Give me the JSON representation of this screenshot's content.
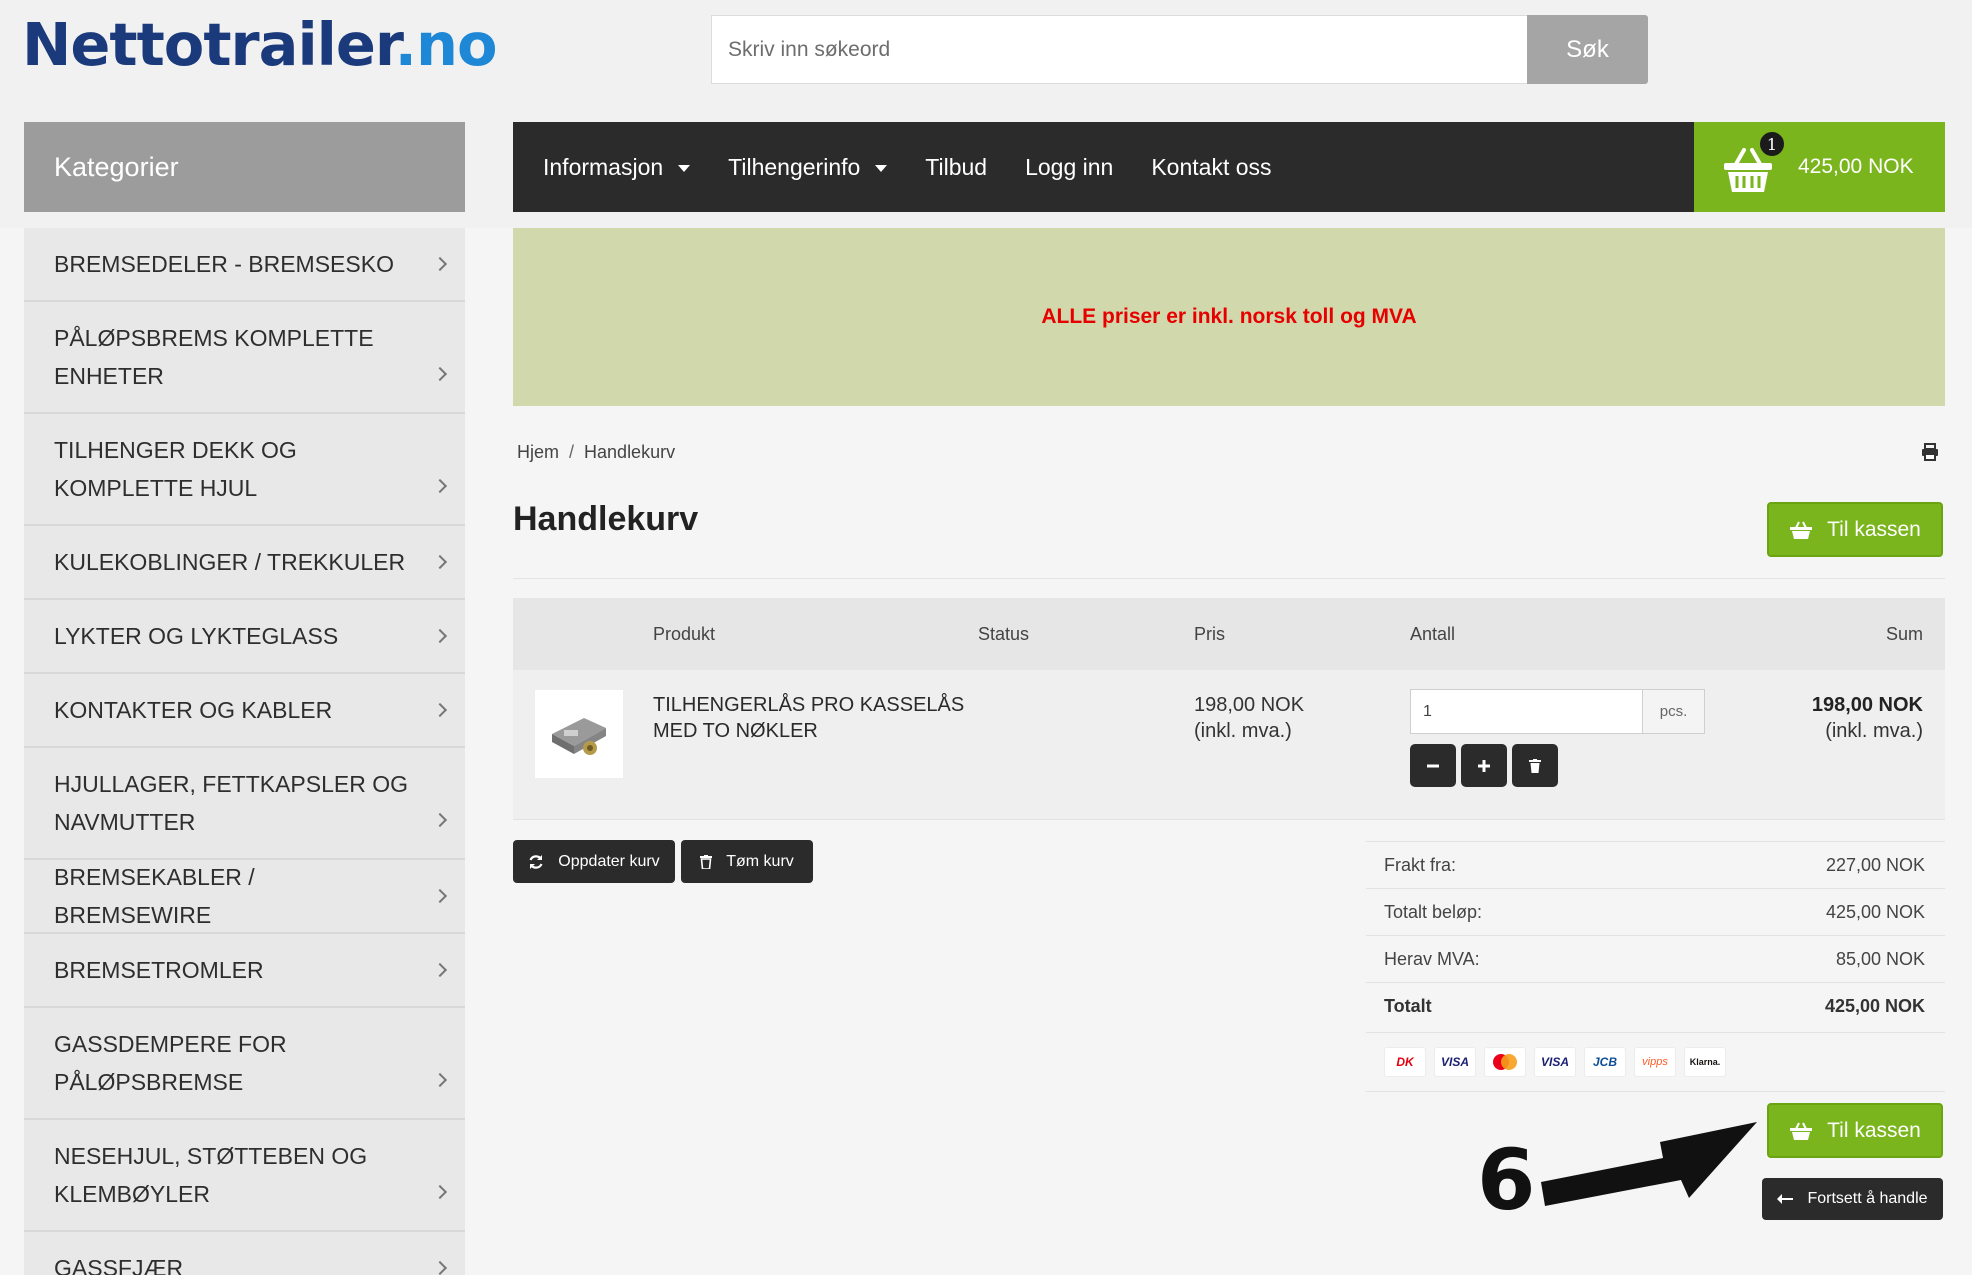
{
  "header": {
    "logo_part1": "Nettotrailer",
    "logo_part2": ".no",
    "search_placeholder": "Skriv inn søkeord",
    "search_button": "Søk"
  },
  "sidebar": {
    "title": "Kategorier",
    "items": [
      {
        "label": "BREMSEDELER - BREMSESKO"
      },
      {
        "label": "PÅLØPSBREMS KOMPLETTE ENHETER"
      },
      {
        "label": "TILHENGER DEKK OG KOMPLETTE HJUL"
      },
      {
        "label": "KULEKOBLINGER / TREKKULER"
      },
      {
        "label": "LYKTER OG LYKTEGLASS"
      },
      {
        "label": "KONTAKTER OG KABLER"
      },
      {
        "label": "HJULLAGER, FETTKAPSLER OG NAVMUTTER"
      },
      {
        "label": "BREMSEKABLER / BREMSEWIRE"
      },
      {
        "label": "BREMSETROMLER"
      },
      {
        "label": "GASSDEMPERE FOR PÅLØPSBREMSE"
      },
      {
        "label": "NESEHJUL, STØTTEBEN OG KLEMBØYLER"
      },
      {
        "label": "GASSFJÆR"
      }
    ]
  },
  "nav": {
    "items": [
      {
        "label": "Informasjon"
      },
      {
        "label": "Tilhengerinfo"
      },
      {
        "label": "Tilbud"
      },
      {
        "label": "Logg inn"
      },
      {
        "label": "Kontakt oss"
      }
    ],
    "cart_count": "1",
    "cart_total": "425,00 NOK"
  },
  "banner": {
    "text": "ALLE priser er inkl. norsk toll og MVA"
  },
  "breadcrumb": {
    "home": "Hjem",
    "separator": "/",
    "current": "Handlekurv"
  },
  "page": {
    "title": "Handlekurv",
    "checkout_label": "Til kassen"
  },
  "table": {
    "columns": {
      "product": "Produkt",
      "status": "Status",
      "price": "Pris",
      "quantity": "Antall",
      "sum": "Sum"
    },
    "row": {
      "name": "TILHENGERLÅS PRO KASSELÅS MED TO NØKLER",
      "status": "",
      "price": "198,00 NOK",
      "price_note": "(inkl. mva.)",
      "quantity": "1",
      "unit": "pcs.",
      "sum": "198,00 NOK",
      "sum_note": "(inkl. mva.)"
    }
  },
  "actions": {
    "update": "Oppdater kurv",
    "empty": "Tøm kurv",
    "continue": "Fortsett å handle"
  },
  "summary": [
    {
      "label": "Frakt fra:",
      "value": "227,00 NOK"
    },
    {
      "label": "Totalt beløp:",
      "value": "425,00 NOK"
    },
    {
      "label": "Herav MVA:",
      "value": "85,00 NOK"
    },
    {
      "label": "Totalt",
      "value": "425,00 NOK"
    }
  ],
  "payment_logos": [
    {
      "label": "DK",
      "color": "#e3000f"
    },
    {
      "label": "VISA",
      "color": "#1a1f71"
    },
    {
      "label": "",
      "color": "#eb001b"
    },
    {
      "label": "VISA",
      "color": "#1a1f71"
    },
    {
      "label": "JCB",
      "color": "#0e4c96"
    },
    {
      "label": "vipps",
      "color": "#ff5b24"
    },
    {
      "label": "Klarna.",
      "color": "#17120f"
    }
  ],
  "annotation": {
    "step": "6"
  },
  "colors": {
    "green": "#7ab51d",
    "dark": "#2b2b2b",
    "banner_bg": "#d1d8ac",
    "banner_text": "#e60000"
  }
}
